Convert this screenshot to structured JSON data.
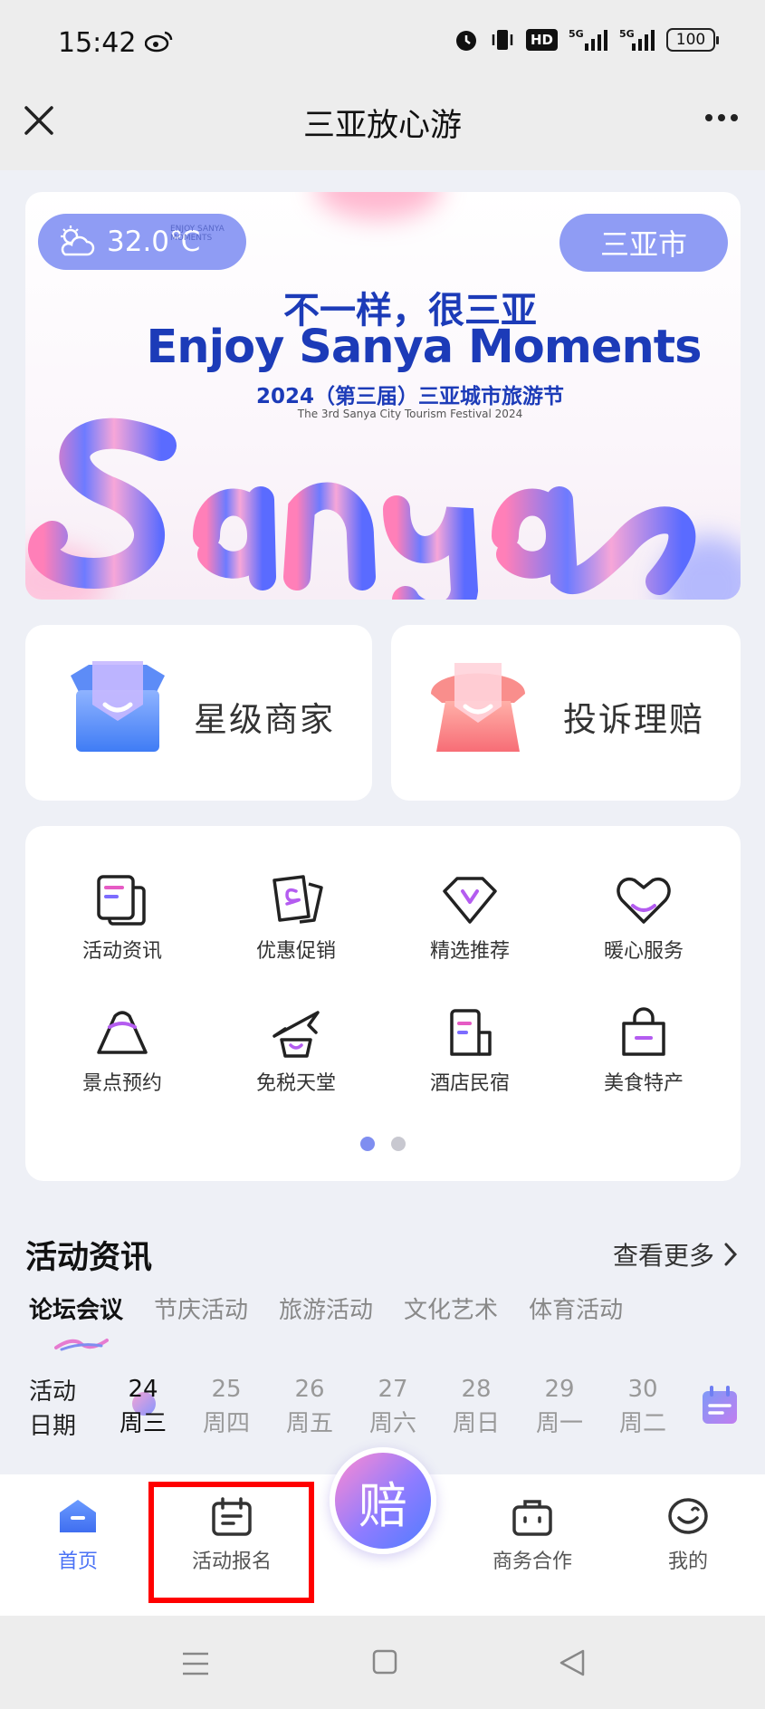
{
  "status_bar": {
    "time": "15:42",
    "hd_label": "HD",
    "battery": "100",
    "network": "5G"
  },
  "nav": {
    "title": "三亚放心游"
  },
  "banner": {
    "temperature": "32.0℃",
    "city": "三亚市",
    "headline_cn": "不一样，很三亚",
    "headline_en": "Enjoy Sanya Moments",
    "festival": "2024（第三届）三亚城市旅游节",
    "festival_en": "The 3rd Sanya City Tourism Festival 2024",
    "logo_text": "ENJOY SANYA MOMENTS"
  },
  "quick_cards": [
    {
      "label": "星级商家",
      "icon": "shop-shield-icon"
    },
    {
      "label": "投诉理赔",
      "icon": "phone-shield-icon"
    }
  ],
  "grid": [
    {
      "label": "活动资讯",
      "icon": "news-icon"
    },
    {
      "label": "优惠促销",
      "icon": "coupon-icon"
    },
    {
      "label": "精选推荐",
      "icon": "diamond-icon"
    },
    {
      "label": "暖心服务",
      "icon": "heart-icon"
    },
    {
      "label": "景点预约",
      "icon": "mountain-icon"
    },
    {
      "label": "免税天堂",
      "icon": "plane-bag-icon"
    },
    {
      "label": "酒店民宿",
      "icon": "hotel-icon"
    },
    {
      "label": "美食特产",
      "icon": "shopping-bag-icon"
    }
  ],
  "pager": {
    "pages": 2,
    "active": 1
  },
  "section": {
    "title": "活动资讯",
    "more": "查看更多"
  },
  "tabs": [
    "论坛会议",
    "节庆活动",
    "旅游活动",
    "文化艺术",
    "体育活动"
  ],
  "active_tab": 0,
  "dates": {
    "label": "活动\n日期",
    "items": [
      {
        "day": "24",
        "weekday": "周三"
      },
      {
        "day": "25",
        "weekday": "周四"
      },
      {
        "day": "26",
        "weekday": "周五"
      },
      {
        "day": "27",
        "weekday": "周六"
      },
      {
        "day": "28",
        "weekday": "周日"
      },
      {
        "day": "29",
        "weekday": "周一"
      },
      {
        "day": "30",
        "weekday": "周二"
      }
    ],
    "active_index": 0
  },
  "tabbar": {
    "items": [
      {
        "label": "首页",
        "icon": "home-icon"
      },
      {
        "label": "活动报名",
        "icon": "calendar-icon"
      },
      {
        "label": "商务合作",
        "icon": "briefcase-icon"
      },
      {
        "label": "我的",
        "icon": "profile-icon"
      }
    ],
    "center_label": "赔",
    "active_index": 0
  },
  "colors": {
    "accent": "#4b72f5",
    "banner_pill": "#8f9cf4",
    "highlight": "#ff0000",
    "banner_text": "#1c3bb8"
  }
}
